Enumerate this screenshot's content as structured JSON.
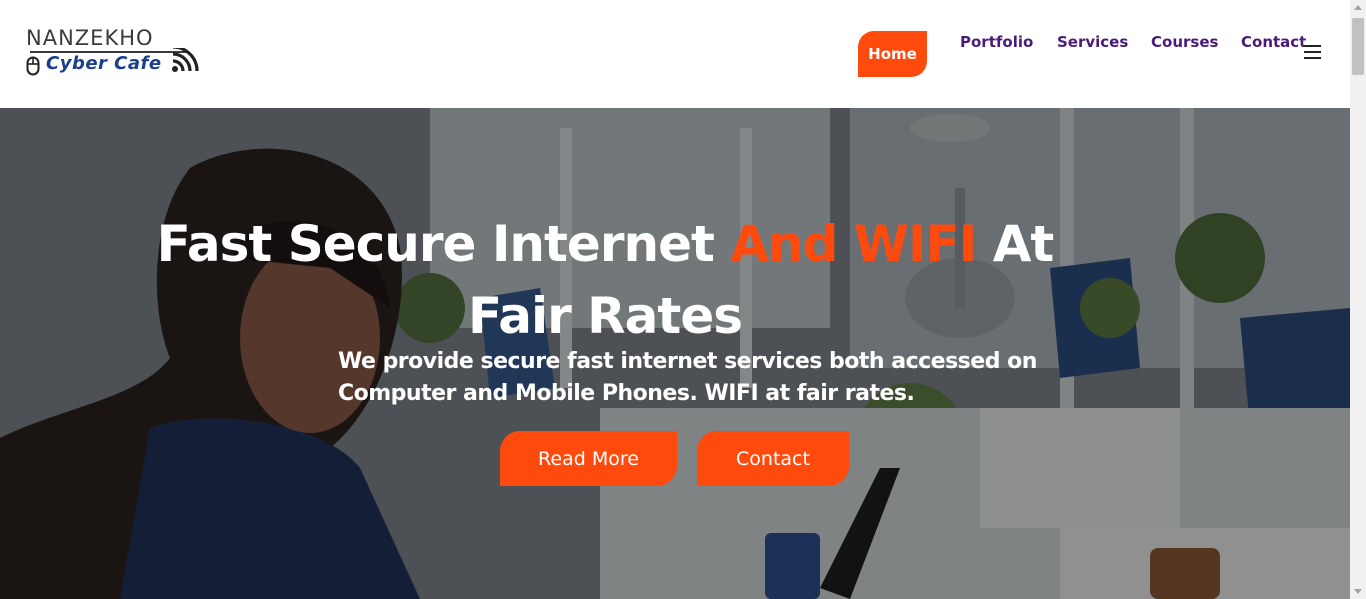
{
  "logo": {
    "top_text": "NANZEKHO",
    "bottom_text": "Cyber Cafe",
    "icons": [
      "mouse-icon",
      "wifi-icon"
    ]
  },
  "nav": {
    "items": [
      {
        "label": "Home",
        "active": true
      },
      {
        "label": "Portfolio",
        "active": false
      },
      {
        "label": "Services",
        "active": false
      },
      {
        "label": "Courses",
        "active": false
      },
      {
        "label": "Contact",
        "active": false
      }
    ],
    "menu_icon": "hamburger-icon"
  },
  "hero": {
    "title_part1": "Fast Secure Internet ",
    "title_accent": "And WIFI",
    "title_part2": " At Fair Rates",
    "subtitle": "We provide secure fast internet services both accessed on Computer and Mobile Phones. WIFI at fair rates.",
    "buttons": {
      "read_more": "Read More",
      "contact": "Contact"
    }
  },
  "colors": {
    "accent": "#ff4a0d",
    "nav_text": "#4b1b78",
    "logo_blue": "#1a3f8f"
  }
}
